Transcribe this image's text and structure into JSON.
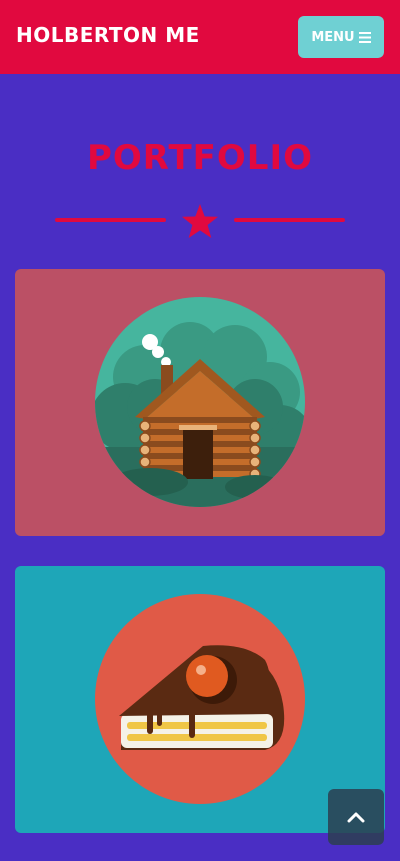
{
  "nav": {
    "brand": "HOLBERTON ME",
    "menu_label": "MENU",
    "menu_icon": "bars-icon"
  },
  "portfolio": {
    "title": "PORTFOLIO",
    "divider_icon": "star-icon",
    "items": [
      {
        "name": "cabin",
        "icon": "cabin-icon",
        "bg": "#bb5065",
        "circle": "#46b59e"
      },
      {
        "name": "cake",
        "icon": "cake-icon",
        "bg": "#1ea6b8",
        "circle": "#e05a47"
      }
    ]
  },
  "colors": {
    "page_bg": "#4a2ec4",
    "accent": "#e1093f",
    "menu_button": "#6fd0d3"
  },
  "scroll_top_icon": "chevron-up-icon"
}
